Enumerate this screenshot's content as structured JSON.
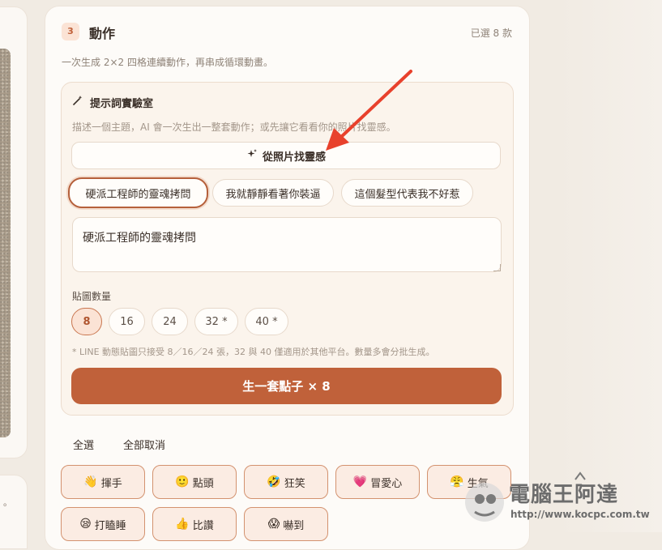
{
  "section": {
    "step_number": "3",
    "title": "動作",
    "selected_count": "已選 8 款",
    "description": "一次生成 2×2 四格連續動作，再串成循環動畫。"
  },
  "lab": {
    "icon": "magic-wand-icon",
    "title": "提示詞實驗室",
    "description": "描述一個主題，AI 會一次生出一整套動作；或先讓它看看你的照片找靈感。",
    "photo_button_icon": "sparkles-icon",
    "photo_button_label": "從照片找靈感",
    "chips": [
      {
        "label": "硬派工程師的靈魂拷問",
        "active": true
      },
      {
        "label": "我就靜靜看著你裝逼",
        "active": false
      },
      {
        "label": "這個髮型代表我不好惹",
        "active": false
      }
    ],
    "prompt_value": "硬派工程師的靈魂拷問",
    "count_label": "貼圖數量",
    "count_options": [
      {
        "label": "8",
        "active": true
      },
      {
        "label": "16",
        "active": false
      },
      {
        "label": "24",
        "active": false
      },
      {
        "label": "32 *",
        "active": false
      },
      {
        "label": "40 *",
        "active": false
      }
    ],
    "count_note": "* LINE 動態貼圖只接受 8／16／24 張，32 與 40 僅適用於其他平台。數量多會分批生成。",
    "generate_label": "生一套點子 × 8"
  },
  "selection": {
    "select_all": "全選",
    "deselect_all": "全部取消"
  },
  "actions": [
    {
      "emoji": "👋",
      "icon": "waving-hand-icon",
      "label": "揮手"
    },
    {
      "emoji": "🙂",
      "icon": "smile-icon",
      "label": "點頭"
    },
    {
      "emoji": "🤣",
      "icon": "laughing-icon",
      "label": "狂笑"
    },
    {
      "emoji": "💗",
      "icon": "heart-icon",
      "label": "冒愛心"
    },
    {
      "emoji": "😤",
      "icon": "huff-icon",
      "label": "生氣"
    },
    {
      "emoji": "😪",
      "icon": "sleepy-icon",
      "label": "打瞌睡"
    },
    {
      "emoji": "👍",
      "icon": "thumbs-up-icon",
      "label": "比讚"
    },
    {
      "emoji": "😱",
      "icon": "scared-icon",
      "label": "嚇到"
    }
  ],
  "watermark": {
    "title": "電腦王阿達",
    "url": "http://www.kocpc.com.tw"
  },
  "colors": {
    "accent": "#c0613a",
    "annotation_arrow": "#e8412c"
  }
}
